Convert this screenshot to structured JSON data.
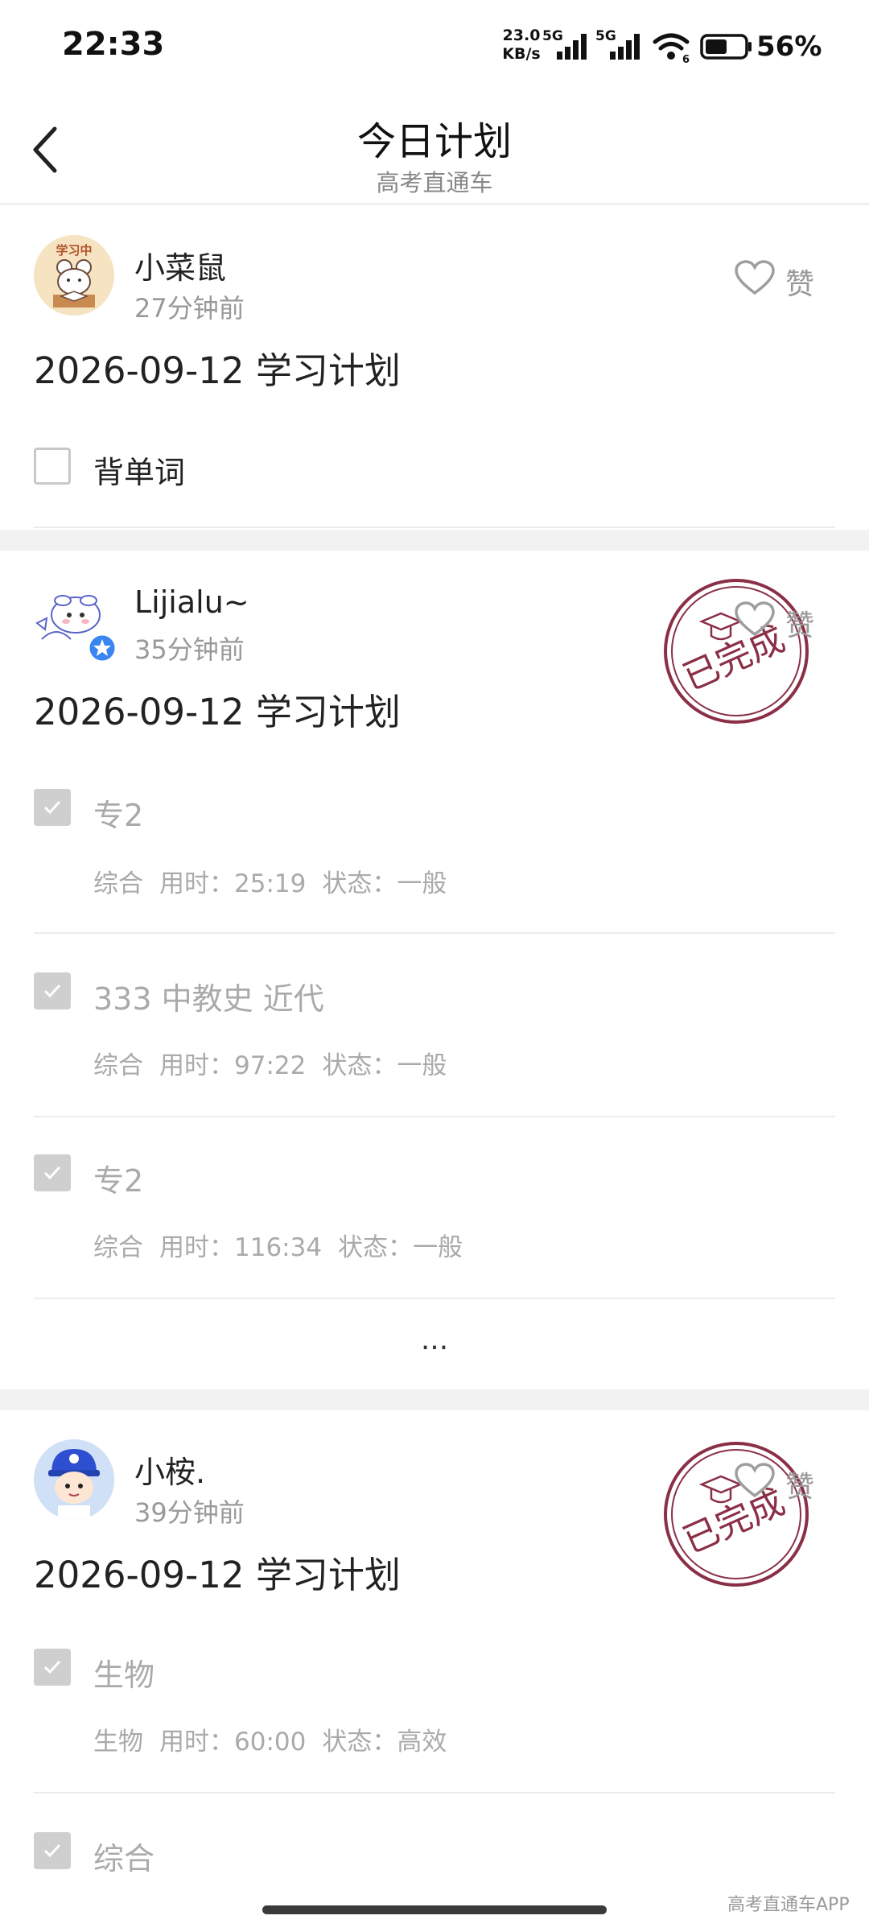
{
  "status_bar": {
    "time": "22:33",
    "net_speed_value": "23.0",
    "net_speed_unit": "KB/s",
    "sim1_label": "5G",
    "sim2_label": "5G",
    "wifi_badge": "6",
    "battery_percent": "56%",
    "battery_level": 0.56
  },
  "nav": {
    "title": "今日计划",
    "subtitle": "高考直通车"
  },
  "posts": [
    {
      "user": "小菜鼠",
      "time": "27分钟前",
      "avatar_text": "学习中",
      "plan_title": "2026-09-12 学习计划",
      "like_label": "赞",
      "completed": false,
      "tasks": [
        {
          "name": "背单词",
          "done": false
        }
      ]
    },
    {
      "user": "Lijialu~",
      "time": "35分钟前",
      "plan_title": "2026-09-12 学习计划",
      "like_label": "赞",
      "completed": true,
      "stamp_text": "已完成",
      "tasks": [
        {
          "name": "专2",
          "done": true,
          "subject": "综合",
          "time_label": "用时：",
          "time": "25:19",
          "status_label": "状态：",
          "status": "一般"
        },
        {
          "name": "333 中教史 近代",
          "done": true,
          "subject": "综合",
          "time_label": "用时：",
          "time": "97:22",
          "status_label": "状态：",
          "status": "一般"
        },
        {
          "name": "专2",
          "done": true,
          "subject": "综合",
          "time_label": "用时：",
          "time": "116:34",
          "status_label": "状态：",
          "status": "一般"
        }
      ],
      "more": "..."
    },
    {
      "user": "小桉.",
      "time": "39分钟前",
      "plan_title": "2026-09-12 学习计划",
      "like_label": "赞",
      "completed": true,
      "stamp_text": "已完成",
      "tasks": [
        {
          "name": "生物",
          "done": true,
          "subject": "生物",
          "time_label": "用时：",
          "time": "60:00",
          "status_label": "状态：",
          "status": "高效"
        },
        {
          "name": "综合",
          "done": true
        }
      ]
    }
  ],
  "watermark": "高考直通车APP",
  "colors": {
    "stamp": "#8a2f45",
    "checkbox_done": "#cfcfcf",
    "muted_text": "#aaaaaa"
  }
}
